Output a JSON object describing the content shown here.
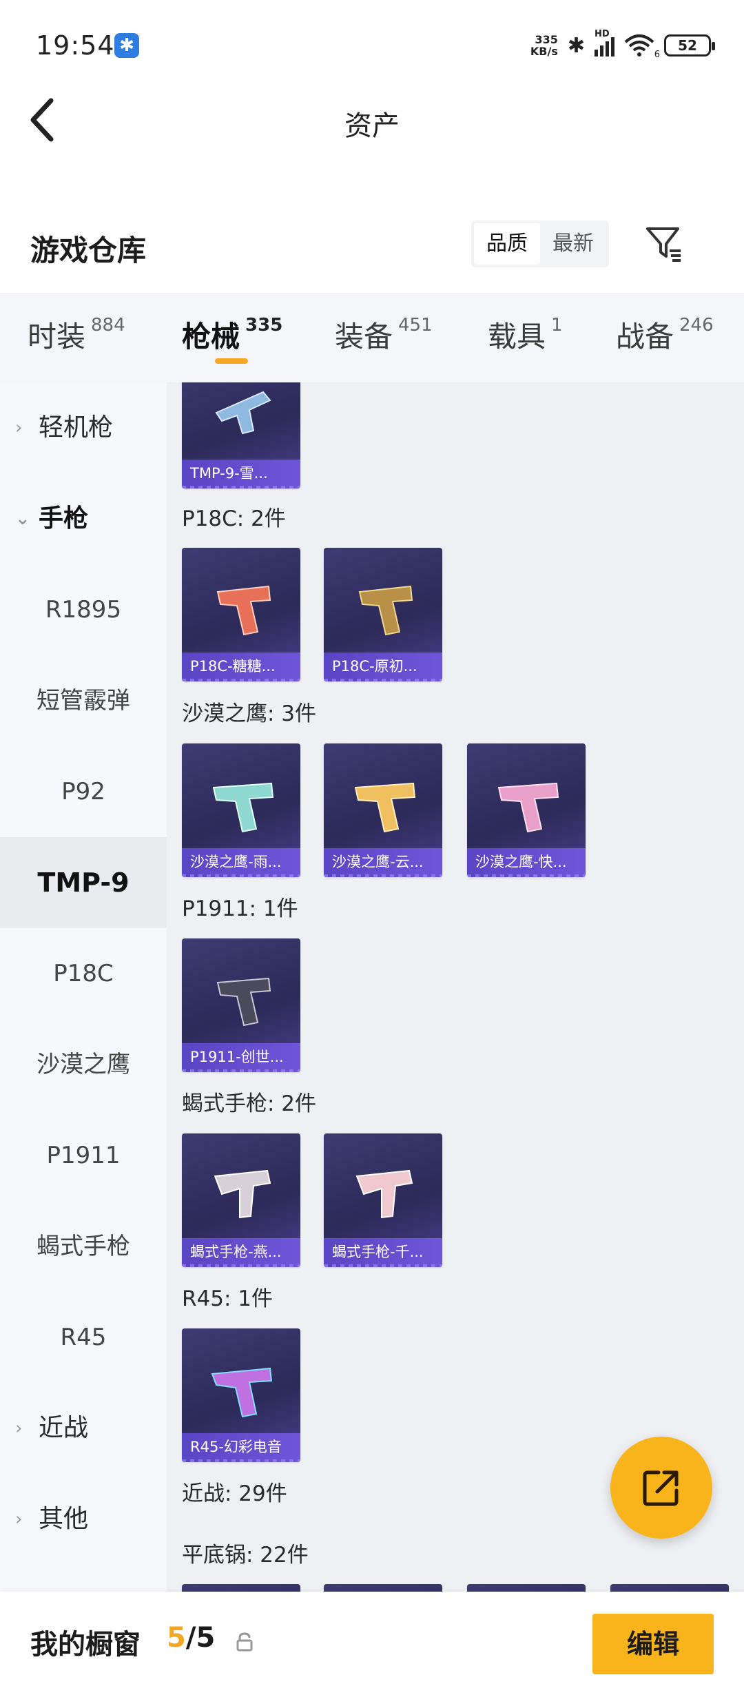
{
  "status_bar": {
    "time": "19:54",
    "net_speed_value": "335",
    "net_speed_unit": "KB/s",
    "icons": [
      "notification-app-icon",
      "bluetooth-icon",
      "signal-icon",
      "wifi-icon",
      "battery-icon"
    ],
    "hd_label": "HD",
    "wifi_label": "6",
    "battery": "52"
  },
  "header": {
    "title": "资产"
  },
  "section": {
    "title": "游戏仓库",
    "sort_options": [
      "品质",
      "最新"
    ],
    "active_sort": "品质"
  },
  "tabs": [
    {
      "label": "时装",
      "count": "884"
    },
    {
      "label": "枪械",
      "count": "335"
    },
    {
      "label": "装备",
      "count": "451"
    },
    {
      "label": "载具",
      "count": "1"
    },
    {
      "label": "战备",
      "count": "246"
    }
  ],
  "active_tab": "枪械",
  "sidebar": {
    "items": [
      {
        "label": "轻机枪",
        "type": "group",
        "expanded": false
      },
      {
        "label": "手枪",
        "type": "group",
        "expanded": true
      },
      {
        "label": "R1895",
        "type": "sub"
      },
      {
        "label": "短管霰弹",
        "type": "sub"
      },
      {
        "label": "P92",
        "type": "sub"
      },
      {
        "label": "TMP-9",
        "type": "sub",
        "active": true
      },
      {
        "label": "P18C",
        "type": "sub"
      },
      {
        "label": "沙漠之鹰",
        "type": "sub"
      },
      {
        "label": "P1911",
        "type": "sub"
      },
      {
        "label": "蝎式手枪",
        "type": "sub"
      },
      {
        "label": "R45",
        "type": "sub"
      },
      {
        "label": "近战",
        "type": "group",
        "expanded": false
      },
      {
        "label": "其他",
        "type": "group",
        "expanded": false
      }
    ]
  },
  "content": {
    "top_card": {
      "name": "TMP-9-雪..."
    },
    "groups": [
      {
        "label": "P18C: 2件",
        "cards": [
          "P18C-糖糖...",
          "P18C-原初..."
        ]
      },
      {
        "label": "沙漠之鹰: 3件",
        "cards": [
          "沙漠之鹰-雨...",
          "沙漠之鹰-云...",
          "沙漠之鹰-快..."
        ]
      },
      {
        "label": "P1911: 1件",
        "cards": [
          "P1911-创世..."
        ]
      },
      {
        "label": "蝎式手枪: 2件",
        "cards": [
          "蝎式手枪-燕...",
          "蝎式手枪-千..."
        ]
      },
      {
        "label": "R45: 1件",
        "cards": [
          "R45-幻彩电音"
        ]
      },
      {
        "label": "近战: 29件",
        "cards": []
      },
      {
        "label": "平底锅: 22件",
        "cards": []
      }
    ]
  },
  "bottom_bar": {
    "title": "我的橱窗",
    "count_current": "5",
    "count_separator": "/",
    "count_total": "5",
    "edit_label": "编辑"
  },
  "colors": {
    "accent": "#f8b41a",
    "card_bg": "#3e3b73",
    "card_label": "#5a45c4"
  }
}
